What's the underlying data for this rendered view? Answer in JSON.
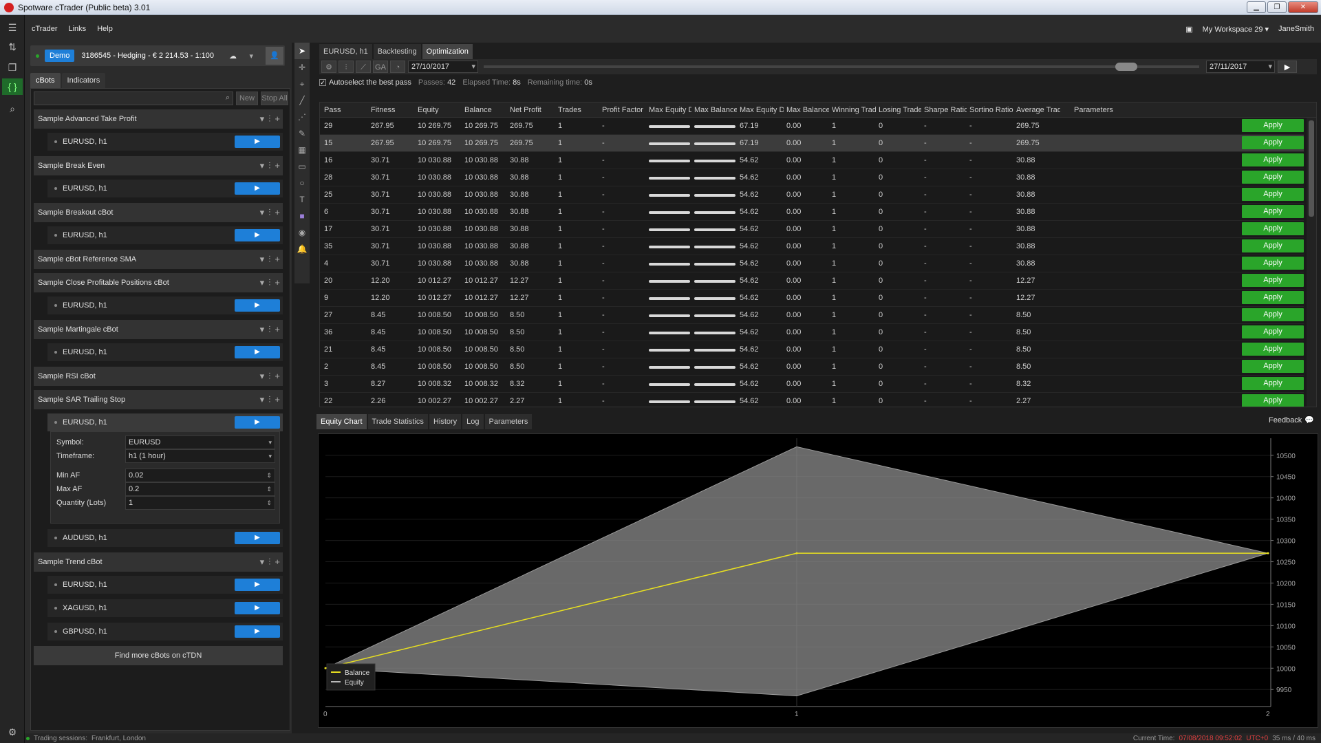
{
  "window": {
    "title": "Spotware cTrader (Public beta) 3.01"
  },
  "menu": {
    "items": [
      "cTrader",
      "Links",
      "Help"
    ],
    "workspace": "My Workspace 29",
    "user": "JaneSmith"
  },
  "account": {
    "mode": "Demo",
    "details": "3186545 - Hedging - € 2 214.53 - 1:100"
  },
  "left_tabs": [
    "cBots",
    "Indicators"
  ],
  "left_buttons": {
    "new": "New",
    "stop_all": "Stop All"
  },
  "find_more": "Find more cBots on cTDN",
  "status": {
    "sessions_label": "Trading sessions:",
    "sessions": "Frankfurt, London",
    "current_time_label": "Current Time:",
    "current_time": "07/08/2018 09:52:02",
    "tz": "UTC+0",
    "latency": "35 ms / 40 ms"
  },
  "params": {
    "symbol_label": "Symbol:",
    "symbol": "EURUSD",
    "timeframe_label": "Timeframe:",
    "timeframe": "h1 (1 hour)",
    "minaf_label": "Min AF",
    "minaf": "0.02",
    "maxaf_label": "Max AF",
    "maxaf": "0.2",
    "qty_label": "Quantity (Lots)",
    "qty": "1"
  },
  "top_tabs": [
    "EURUSD, h1",
    "Backtesting",
    "Optimization"
  ],
  "opt": {
    "from": "27/10/2017",
    "to": "27/11/2017",
    "ga": "GA",
    "autoselect": "Autoselect the best pass",
    "passes_label": "Passes:",
    "passes": "42",
    "elapsed_label": "Elapsed Time:",
    "elapsed": "8s",
    "remaining_label": "Remaining time:",
    "remaining": "0s"
  },
  "grid": {
    "headers": [
      "Pass",
      "Fitness",
      "Equity",
      "Balance",
      "Net Profit",
      "Trades",
      "Profit Factor",
      "Max Equity Dr...",
      "Max Balance...",
      "Max Equity Dr...",
      "Max Balance...",
      "Winning Trades",
      "Losing Trades",
      "Sharpe Ratio",
      "Sortino Ratio",
      "Average Trade",
      "Parameters"
    ],
    "apply_label": "Apply",
    "rows": [
      [
        "29",
        "267.95",
        "10 269.75",
        "10 269.75",
        "269.75",
        "1",
        "-",
        "67.19",
        "0.00",
        "1",
        "0",
        "-",
        "-",
        "269.75"
      ],
      [
        "15",
        "267.95",
        "10 269.75",
        "10 269.75",
        "269.75",
        "1",
        "-",
        "67.19",
        "0.00",
        "1",
        "0",
        "-",
        "-",
        "269.75"
      ],
      [
        "16",
        "30.71",
        "10 030.88",
        "10 030.88",
        "30.88",
        "1",
        "-",
        "54.62",
        "0.00",
        "1",
        "0",
        "-",
        "-",
        "30.88"
      ],
      [
        "28",
        "30.71",
        "10 030.88",
        "10 030.88",
        "30.88",
        "1",
        "-",
        "54.62",
        "0.00",
        "1",
        "0",
        "-",
        "-",
        "30.88"
      ],
      [
        "25",
        "30.71",
        "10 030.88",
        "10 030.88",
        "30.88",
        "1",
        "-",
        "54.62",
        "0.00",
        "1",
        "0",
        "-",
        "-",
        "30.88"
      ],
      [
        "6",
        "30.71",
        "10 030.88",
        "10 030.88",
        "30.88",
        "1",
        "-",
        "54.62",
        "0.00",
        "1",
        "0",
        "-",
        "-",
        "30.88"
      ],
      [
        "17",
        "30.71",
        "10 030.88",
        "10 030.88",
        "30.88",
        "1",
        "-",
        "54.62",
        "0.00",
        "1",
        "0",
        "-",
        "-",
        "30.88"
      ],
      [
        "35",
        "30.71",
        "10 030.88",
        "10 030.88",
        "30.88",
        "1",
        "-",
        "54.62",
        "0.00",
        "1",
        "0",
        "-",
        "-",
        "30.88"
      ],
      [
        "4",
        "30.71",
        "10 030.88",
        "10 030.88",
        "30.88",
        "1",
        "-",
        "54.62",
        "0.00",
        "1",
        "0",
        "-",
        "-",
        "30.88"
      ],
      [
        "20",
        "12.20",
        "10 012.27",
        "10 012.27",
        "12.27",
        "1",
        "-",
        "54.62",
        "0.00",
        "1",
        "0",
        "-",
        "-",
        "12.27"
      ],
      [
        "9",
        "12.20",
        "10 012.27",
        "10 012.27",
        "12.27",
        "1",
        "-",
        "54.62",
        "0.00",
        "1",
        "0",
        "-",
        "-",
        "12.27"
      ],
      [
        "27",
        "8.45",
        "10 008.50",
        "10 008.50",
        "8.50",
        "1",
        "-",
        "54.62",
        "0.00",
        "1",
        "0",
        "-",
        "-",
        "8.50"
      ],
      [
        "36",
        "8.45",
        "10 008.50",
        "10 008.50",
        "8.50",
        "1",
        "-",
        "54.62",
        "0.00",
        "1",
        "0",
        "-",
        "-",
        "8.50"
      ],
      [
        "21",
        "8.45",
        "10 008.50",
        "10 008.50",
        "8.50",
        "1",
        "-",
        "54.62",
        "0.00",
        "1",
        "0",
        "-",
        "-",
        "8.50"
      ],
      [
        "2",
        "8.45",
        "10 008.50",
        "10 008.50",
        "8.50",
        "1",
        "-",
        "54.62",
        "0.00",
        "1",
        "0",
        "-",
        "-",
        "8.50"
      ],
      [
        "3",
        "8.27",
        "10 008.32",
        "10 008.32",
        "8.32",
        "1",
        "-",
        "54.62",
        "0.00",
        "1",
        "0",
        "-",
        "-",
        "8.32"
      ],
      [
        "22",
        "2.26",
        "10 002.27",
        "10 002.27",
        "2.27",
        "1",
        "-",
        "54.62",
        "0.00",
        "1",
        "0",
        "-",
        "-",
        "2.27"
      ]
    ]
  },
  "bottom_tabs": [
    "Equity Chart",
    "Trade Statistics",
    "History",
    "Log",
    "Parameters"
  ],
  "feedback": "Feedback",
  "chart_data": {
    "type": "line",
    "x": [
      0,
      1,
      2
    ],
    "series": [
      {
        "name": "Balance",
        "values": [
          10000,
          10270,
          10270
        ],
        "color": "#e8e020"
      },
      {
        "name": "Equity",
        "values": [
          10000,
          10520,
          10270
        ],
        "color": "#bbbbbb",
        "band_low": [
          10000,
          9935,
          10270
        ]
      }
    ],
    "yticks": [
      10500,
      10450,
      10400,
      10350,
      10300,
      10250,
      10200,
      10150,
      10100,
      10050,
      10000,
      9950
    ],
    "xticks": [
      "0",
      "1",
      "2"
    ],
    "ylim": [
      9910,
      10540
    ]
  }
}
